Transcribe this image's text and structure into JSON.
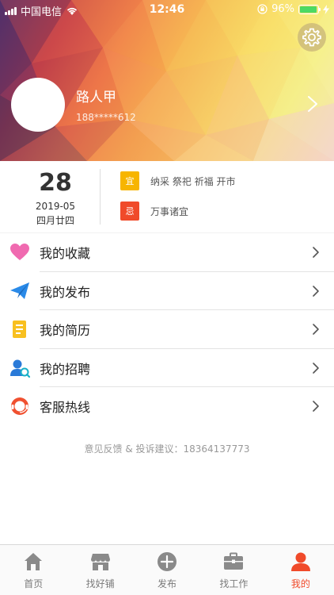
{
  "status_bar": {
    "carrier": "中国电信",
    "time": "12:46",
    "battery": "96%",
    "battery_level": 0.96
  },
  "profile": {
    "name": "路人甲",
    "phone": "188*****612"
  },
  "calendar": {
    "day": "28",
    "month": "2019-05",
    "lunar": "四月廿四",
    "good_badge": "宜",
    "good_text": "纳采 祭祀 祈福 开市",
    "bad_badge": "忌",
    "bad_text": "万事诸宜"
  },
  "menu": {
    "items": [
      {
        "label": "我的收藏",
        "icon": "heart-icon"
      },
      {
        "label": "我的发布",
        "icon": "paper-plane-icon"
      },
      {
        "label": "我的简历",
        "icon": "document-icon"
      },
      {
        "label": "我的招聘",
        "icon": "recruit-person-icon"
      },
      {
        "label": "客服热线",
        "icon": "customer-service-icon"
      }
    ]
  },
  "feedback": "意见反馈 & 投诉建议：18364137773",
  "tabbar": {
    "items": [
      {
        "label": "首页",
        "icon": "home-icon"
      },
      {
        "label": "找好铺",
        "icon": "shop-icon"
      },
      {
        "label": "发布",
        "icon": "plus-circle-icon"
      },
      {
        "label": "找工作",
        "icon": "briefcase-icon"
      },
      {
        "label": "我的",
        "icon": "person-icon",
        "active": true
      }
    ]
  },
  "colors": {
    "accent": "#f04a2a",
    "good_badge": "#f7b500",
    "bad_badge": "#f04a2a"
  }
}
